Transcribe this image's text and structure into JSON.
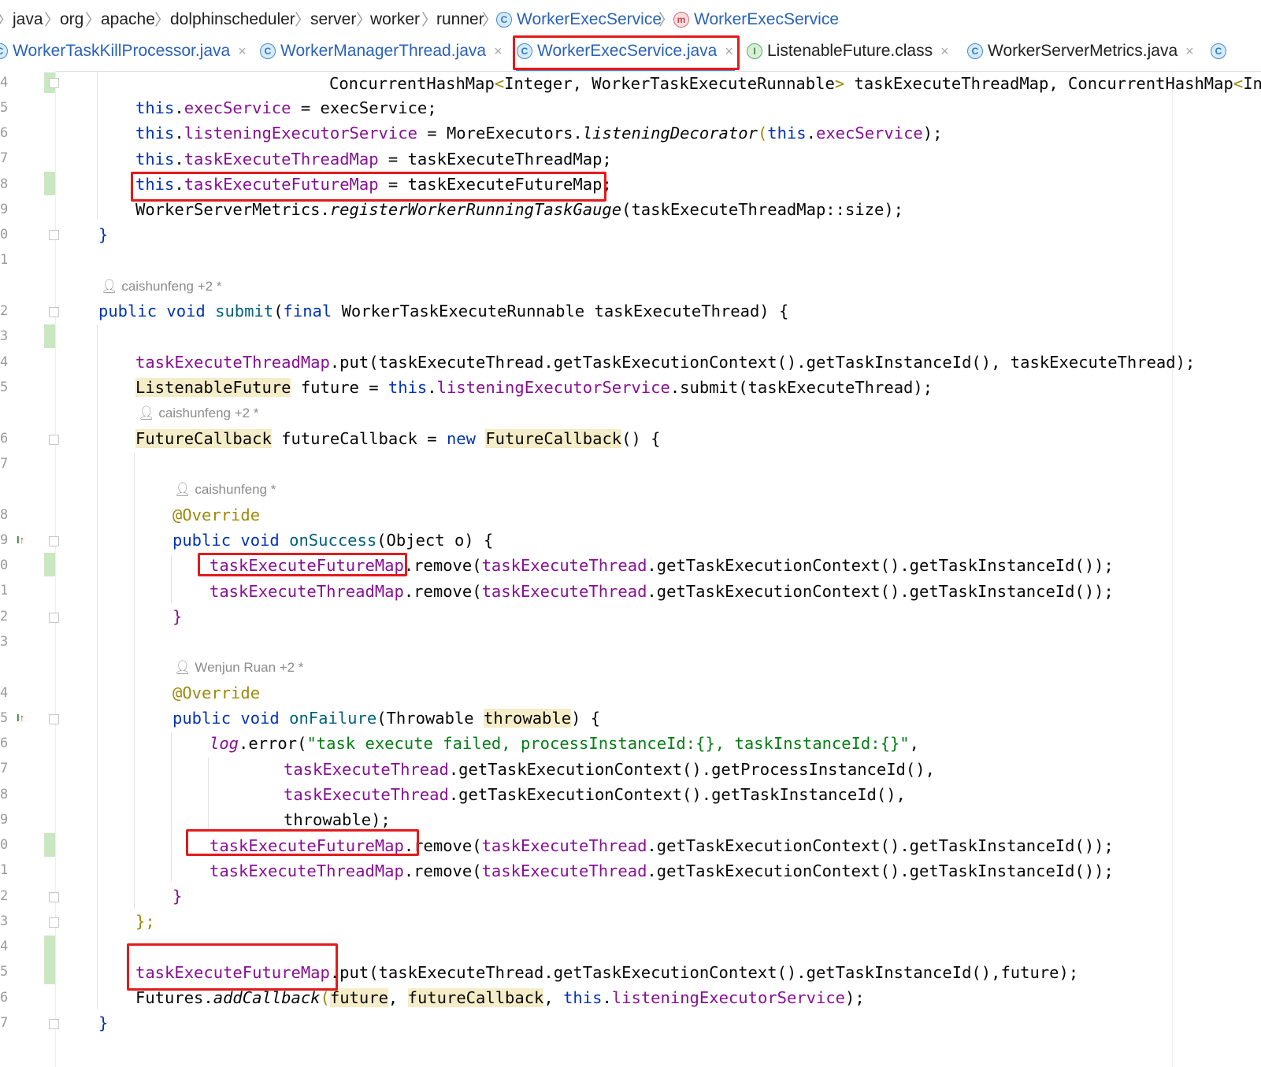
{
  "breadcrumb": [
    "java",
    "org",
    "apache",
    "dolphinscheduler",
    "server",
    "worker",
    "runner",
    "WorkerExecService",
    "WorkerExecService"
  ],
  "tabs": [
    {
      "label": "WorkerTaskKillProcessor.java",
      "close": "×"
    },
    {
      "label": "WorkerManagerThread.java",
      "close": "×"
    },
    {
      "label": "WorkerExecService.java",
      "close": "×"
    },
    {
      "label": "ListenableFuture.class",
      "close": "×"
    },
    {
      "label": "WorkerServerMetrics.java",
      "close": "×"
    }
  ],
  "gutter": {
    "line_numbers": [
      "4",
      "5",
      "6",
      "7",
      "8",
      "9",
      "0",
      "1",
      "2",
      "3",
      "4",
      "5",
      "6",
      "7",
      "8",
      "9",
      "0",
      "1",
      "2",
      "3",
      "4",
      "5",
      "6",
      "7",
      "8",
      "9",
      "0",
      "1",
      "2",
      "3",
      "4",
      "5",
      "6",
      "7"
    ]
  },
  "hints": {
    "h1": "caishunfeng +2 *",
    "h2": "caishunfeng +2 *",
    "h3": "caishunfeng *",
    "h4": "Wenjun Ruan +2 *"
  },
  "code": {
    "l1_a": "ConcurrentHashMap",
    "l1_b": "<",
    "l1_c": "Integer, WorkerTaskExecuteRunnable",
    "l1_d": ">",
    "l1_e": " taskExecuteThreadMap, ConcurrentHashMap",
    "l1_f": "<",
    "l1_g": "Int",
    "this": "this",
    "l2_fld": "execService",
    "l2_rest": " = execService;",
    "l3_fld": "listeningExecutorService",
    "l3_mid": " = MoreExecutors.",
    "l3_m": "listeningDecorator",
    "l3_p": "(",
    "l3_this": "this",
    "l3_dot": ".",
    "l3_f2": "execService",
    "l3_end": ");",
    "l4_fld": "taskExecuteThreadMap",
    "l4_rest": " = taskExecuteThreadMap;",
    "l5_fld": "taskExecuteFutureMap",
    "l5_rest": " = taskExecuteFutureMap;",
    "l6_a": "WorkerServerMetrics.",
    "l6_m": "registerWorkerRunningTaskGauge",
    "l6_b": "(taskExecuteThreadMap::size);",
    "brace_close": "}",
    "kw_public": "public",
    "kw_void": "void",
    "l9_m": "submit",
    "l9_a": "(",
    "kw_final": "final",
    "l9_b": " WorkerTaskExecuteRunnable taskExecuteThread) {",
    "l10_fld": "taskExecuteThreadMap",
    "l10_rest": ".put(taskExecuteThread.getTaskExecutionContext().getTaskInstanceId(), taskExecuteThread);",
    "l11_t": "ListenableFuture",
    "l11_a": " future = ",
    "l11_dot": ".",
    "l11_fld": "listeningExecutorService",
    "l11_rest": ".submit(taskExecuteThread);",
    "l12_t": "FutureCallback",
    "l12_a": " futureCallback = ",
    "kw_new": "new",
    "l12_t2": "FutureCallback",
    "l12_b": "() {",
    "override": "@Override",
    "l14_m": "onSuccess",
    "l14_rest": "(Object o) {",
    "futmap": "taskExecuteFutureMap",
    "thrmap": "taskExecuteThreadMap",
    "remove_open": ".remove(",
    "execthread": "taskExecuteThread",
    "ctx_tail": ".getTaskExecutionContext().getTaskInstanceId());",
    "l19_m": "onFailure",
    "l19_a": "(Throwable ",
    "l19_p": "throwable",
    "l19_b": ") {",
    "l20_log": "log",
    "l20_a": ".error(",
    "l20_s": "\"task execute failed, processInstanceId:{}, taskInstanceId:{}\"",
    "l20_b": ",",
    "l21_tail": ".getTaskExecutionContext().getProcessInstanceId(),",
    "l22_tail": ".getTaskExecutionContext().getTaskInstanceId(),",
    "l23": "throwable);",
    "l27_end": "};",
    "l28_rest": ".put(taskExecuteThread.getTaskExecutionContext().getTaskInstanceId(),future);",
    "l29_a": "Futures.",
    "l29_m": "addCallback",
    "l29_b": "(",
    "l29_f": "future",
    "l29_c": ", ",
    "l29_cb": "futureCallback",
    "l29_d": ", ",
    "l29_e": ".",
    "l29_fld": "listeningExecutorService",
    "l29_end": ");"
  },
  "colors": {
    "keyword": "#0033b3",
    "field": "#871094",
    "method": "#00627a",
    "string": "#067d17",
    "annotation": "#9e880d",
    "highlight_box": "#e21b1b"
  }
}
